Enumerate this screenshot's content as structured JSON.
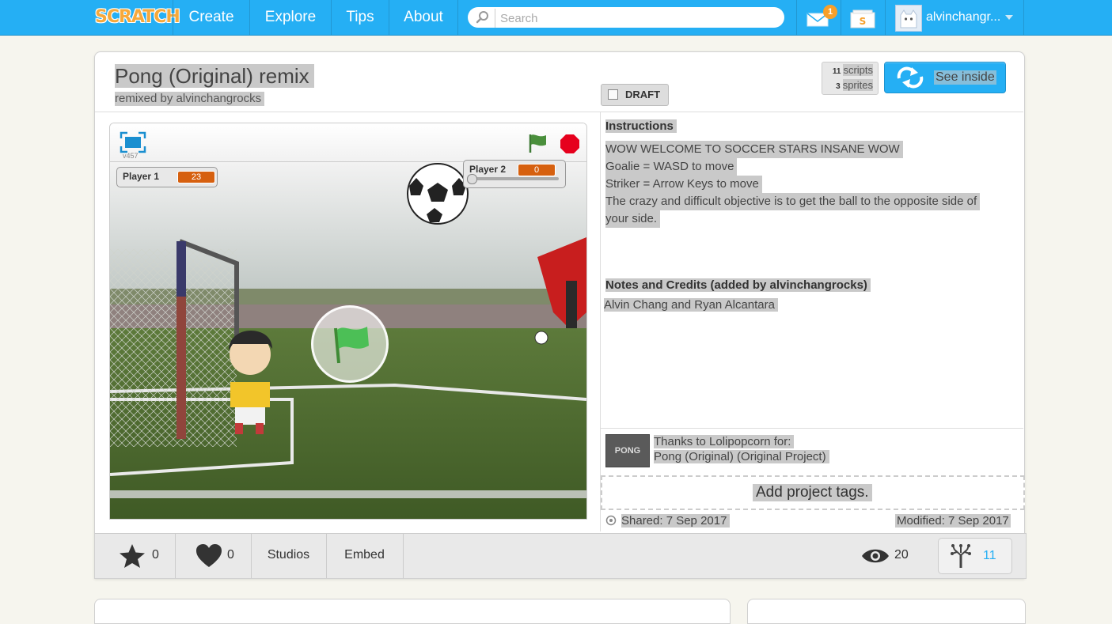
{
  "nav": {
    "logo": "SCRATCH",
    "create": "Create",
    "explore": "Explore",
    "tips": "Tips",
    "about": "About",
    "search_placeholder": "Search",
    "mail_badge": "1",
    "username": "alvinchangr..."
  },
  "project": {
    "title": "Pong (Original) remix",
    "remixed_by": "remixed by alvinchangrocks",
    "draft_label": "DRAFT",
    "scripts_count": "11",
    "scripts_label": "scripts",
    "sprites_count": "3",
    "sprites_label": "sprites",
    "see_inside": "See inside",
    "version": "v457"
  },
  "stage": {
    "var1_label": "Player 1",
    "var1_value": "23",
    "var2_label": "Player 2",
    "var2_value": "0",
    "var2_slider_fraction": 0
  },
  "info": {
    "instructions_heading": "Instructions",
    "instructions_lines": [
      "WOW WELCOME TO SOCCER STARS INSANE WOW",
      "Goalie = WASD to move",
      "Striker = Arrow Keys to move",
      "The crazy and difficult objective is to get the ball to the opposite side of",
      "your side."
    ],
    "notes_heading": "Notes and Credits (added by alvinchangrocks)",
    "credits": "Alvin Chang and Ryan Alcantara",
    "thanks_line1": "Thanks to Lolipopcorn for:",
    "thanks_line2": "Pong (Original) (Original Project)",
    "thumb_text": "PONG",
    "add_tags": "Add project tags.",
    "shared": "Shared: 7 Sep 2017",
    "modified": "Modified: 7 Sep 2017"
  },
  "actions": {
    "favorites": "0",
    "loves": "0",
    "studios": "Studios",
    "embed": "Embed",
    "views": "20",
    "remixes": "11"
  },
  "colors": {
    "nav_blue": "#25aff4",
    "var_orange": "#d6600f",
    "flag_green": "#4cbf56",
    "stop_red": "#e6001d"
  }
}
